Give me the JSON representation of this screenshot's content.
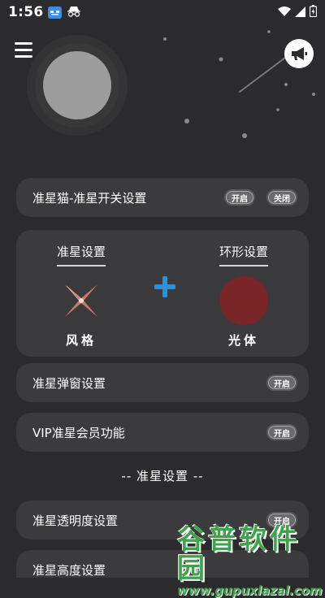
{
  "status_bar": {
    "time": "1:56"
  },
  "header": {
    "menu_icon": "hamburger-icon",
    "announcement_icon": "megaphone-icon"
  },
  "toggle_card": {
    "label": "准星猫-准星开关设置",
    "on_label": "开启",
    "off_label": "关闭"
  },
  "setting_panel": {
    "left_title": "准星设置",
    "left_caption": "风格",
    "right_title": "环形设置",
    "right_caption": "光体",
    "ring_color": "#7a2528",
    "crosshair_color": "#d98a74",
    "plus_color": "#2b92d9"
  },
  "popup_row": {
    "label": "准星弹窗设置",
    "button": "开启"
  },
  "vip_row": {
    "label": "VIP准星会员功能",
    "button": "开启"
  },
  "section_title": "-- 准星设置 --",
  "opacity_row": {
    "label": "准星透明度设置",
    "button": "开启"
  },
  "height_row": {
    "label": "准星高度设置"
  },
  "watermark": {
    "main": "谷普软件园",
    "url": "www.gupuxlazal.com"
  }
}
